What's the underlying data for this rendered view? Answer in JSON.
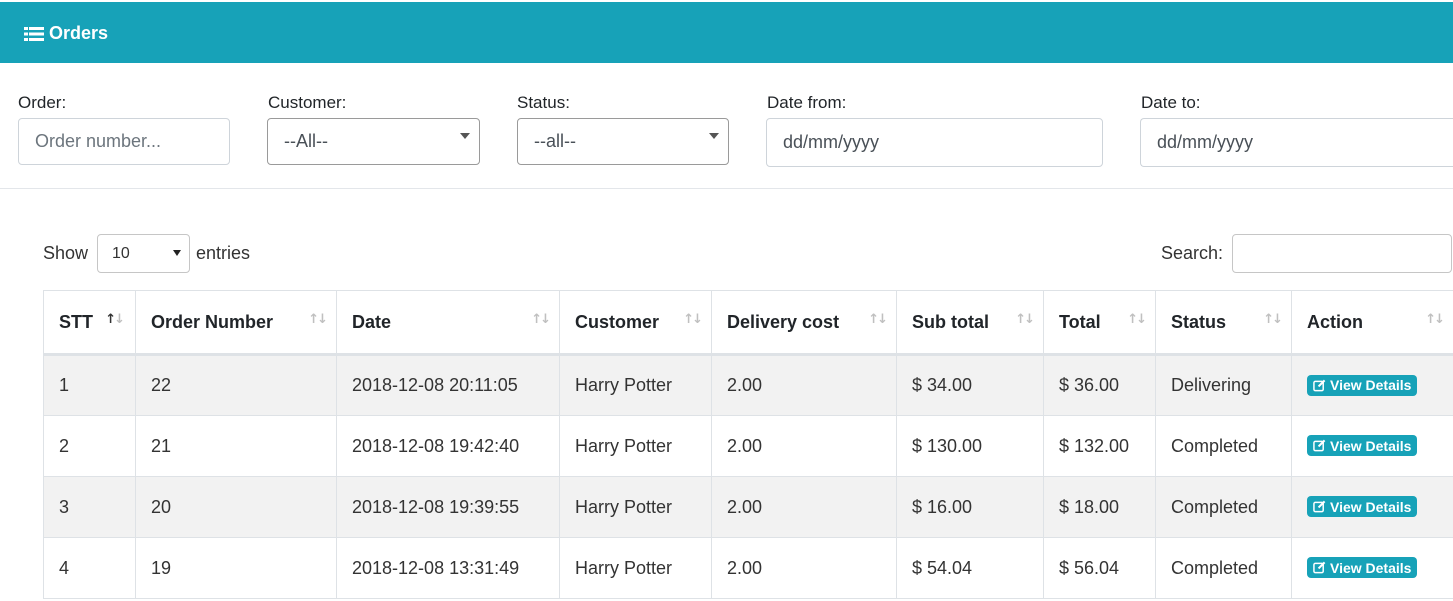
{
  "header": {
    "title": "Orders",
    "icon": "list-icon",
    "color": "#17a2b8"
  },
  "filters": {
    "order": {
      "label": "Order:",
      "placeholder": "Order number..."
    },
    "customer": {
      "label": "Customer:",
      "value": "--All--"
    },
    "status": {
      "label": "Status:",
      "value": "--all--"
    },
    "date_from": {
      "label": "Date from:",
      "value": "dd/mm/yyyy"
    },
    "date_to": {
      "label": "Date to:",
      "value": "dd/mm/yyyy"
    }
  },
  "table_controls": {
    "show_label": "Show",
    "entries_value": "10",
    "entries_label": "entries",
    "search_label": "Search:"
  },
  "table": {
    "columns": [
      "STT",
      "Order Number",
      "Date",
      "Customer",
      "Delivery cost",
      "Sub total",
      "Total",
      "Status",
      "Action"
    ],
    "action_label": "View Details",
    "rows": [
      {
        "stt": "1",
        "order_number": "22",
        "date": "2018-12-08 20:11:05",
        "customer": "Harry Potter",
        "delivery_cost": "2.00",
        "sub_total": "$ 34.00",
        "total": "$ 36.00",
        "status": "Delivering"
      },
      {
        "stt": "2",
        "order_number": "21",
        "date": "2018-12-08 19:42:40",
        "customer": "Harry Potter",
        "delivery_cost": "2.00",
        "sub_total": "$ 130.00",
        "total": "$ 132.00",
        "status": "Completed"
      },
      {
        "stt": "3",
        "order_number": "20",
        "date": "2018-12-08 19:39:55",
        "customer": "Harry Potter",
        "delivery_cost": "2.00",
        "sub_total": "$ 16.00",
        "total": "$ 18.00",
        "status": "Completed"
      },
      {
        "stt": "4",
        "order_number": "19",
        "date": "2018-12-08 13:31:49",
        "customer": "Harry Potter",
        "delivery_cost": "2.00",
        "sub_total": "$ 54.04",
        "total": "$ 56.04",
        "status": "Completed"
      }
    ]
  }
}
